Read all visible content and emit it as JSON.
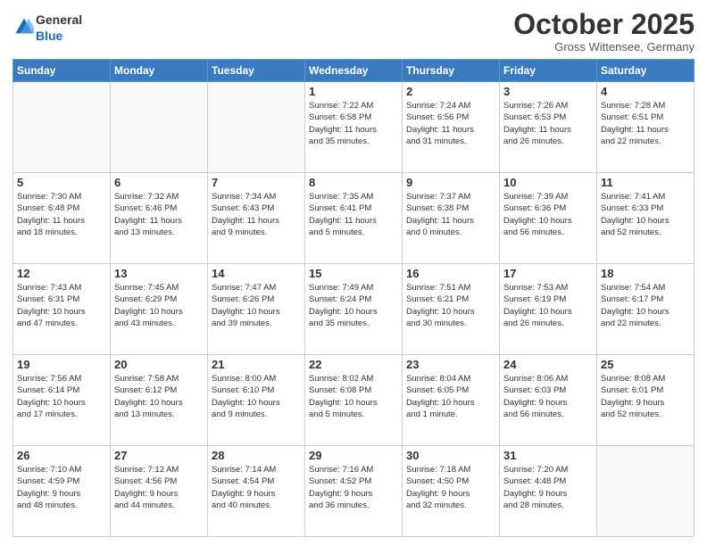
{
  "header": {
    "logo_general": "General",
    "logo_blue": "Blue",
    "month_title": "October 2025",
    "location": "Gross Wittensee, Germany"
  },
  "weekdays": [
    "Sunday",
    "Monday",
    "Tuesday",
    "Wednesday",
    "Thursday",
    "Friday",
    "Saturday"
  ],
  "weeks": [
    [
      {
        "day": "",
        "info": ""
      },
      {
        "day": "",
        "info": ""
      },
      {
        "day": "",
        "info": ""
      },
      {
        "day": "1",
        "info": "Sunrise: 7:22 AM\nSunset: 6:58 PM\nDaylight: 11 hours\nand 35 minutes."
      },
      {
        "day": "2",
        "info": "Sunrise: 7:24 AM\nSunset: 6:56 PM\nDaylight: 11 hours\nand 31 minutes."
      },
      {
        "day": "3",
        "info": "Sunrise: 7:26 AM\nSunset: 6:53 PM\nDaylight: 11 hours\nand 26 minutes."
      },
      {
        "day": "4",
        "info": "Sunrise: 7:28 AM\nSunset: 6:51 PM\nDaylight: 11 hours\nand 22 minutes."
      }
    ],
    [
      {
        "day": "5",
        "info": "Sunrise: 7:30 AM\nSunset: 6:48 PM\nDaylight: 11 hours\nand 18 minutes."
      },
      {
        "day": "6",
        "info": "Sunrise: 7:32 AM\nSunset: 6:46 PM\nDaylight: 11 hours\nand 13 minutes."
      },
      {
        "day": "7",
        "info": "Sunrise: 7:34 AM\nSunset: 6:43 PM\nDaylight: 11 hours\nand 9 minutes."
      },
      {
        "day": "8",
        "info": "Sunrise: 7:35 AM\nSunset: 6:41 PM\nDaylight: 11 hours\nand 5 minutes."
      },
      {
        "day": "9",
        "info": "Sunrise: 7:37 AM\nSunset: 6:38 PM\nDaylight: 11 hours\nand 0 minutes."
      },
      {
        "day": "10",
        "info": "Sunrise: 7:39 AM\nSunset: 6:36 PM\nDaylight: 10 hours\nand 56 minutes."
      },
      {
        "day": "11",
        "info": "Sunrise: 7:41 AM\nSunset: 6:33 PM\nDaylight: 10 hours\nand 52 minutes."
      }
    ],
    [
      {
        "day": "12",
        "info": "Sunrise: 7:43 AM\nSunset: 6:31 PM\nDaylight: 10 hours\nand 47 minutes."
      },
      {
        "day": "13",
        "info": "Sunrise: 7:45 AM\nSunset: 6:29 PM\nDaylight: 10 hours\nand 43 minutes."
      },
      {
        "day": "14",
        "info": "Sunrise: 7:47 AM\nSunset: 6:26 PM\nDaylight: 10 hours\nand 39 minutes."
      },
      {
        "day": "15",
        "info": "Sunrise: 7:49 AM\nSunset: 6:24 PM\nDaylight: 10 hours\nand 35 minutes."
      },
      {
        "day": "16",
        "info": "Sunrise: 7:51 AM\nSunset: 6:21 PM\nDaylight: 10 hours\nand 30 minutes."
      },
      {
        "day": "17",
        "info": "Sunrise: 7:53 AM\nSunset: 6:19 PM\nDaylight: 10 hours\nand 26 minutes."
      },
      {
        "day": "18",
        "info": "Sunrise: 7:54 AM\nSunset: 6:17 PM\nDaylight: 10 hours\nand 22 minutes."
      }
    ],
    [
      {
        "day": "19",
        "info": "Sunrise: 7:56 AM\nSunset: 6:14 PM\nDaylight: 10 hours\nand 17 minutes."
      },
      {
        "day": "20",
        "info": "Sunrise: 7:58 AM\nSunset: 6:12 PM\nDaylight: 10 hours\nand 13 minutes."
      },
      {
        "day": "21",
        "info": "Sunrise: 8:00 AM\nSunset: 6:10 PM\nDaylight: 10 hours\nand 9 minutes."
      },
      {
        "day": "22",
        "info": "Sunrise: 8:02 AM\nSunset: 6:08 PM\nDaylight: 10 hours\nand 5 minutes."
      },
      {
        "day": "23",
        "info": "Sunrise: 8:04 AM\nSunset: 6:05 PM\nDaylight: 10 hours\nand 1 minute."
      },
      {
        "day": "24",
        "info": "Sunrise: 8:06 AM\nSunset: 6:03 PM\nDaylight: 9 hours\nand 56 minutes."
      },
      {
        "day": "25",
        "info": "Sunrise: 8:08 AM\nSunset: 6:01 PM\nDaylight: 9 hours\nand 52 minutes."
      }
    ],
    [
      {
        "day": "26",
        "info": "Sunrise: 7:10 AM\nSunset: 4:59 PM\nDaylight: 9 hours\nand 48 minutes."
      },
      {
        "day": "27",
        "info": "Sunrise: 7:12 AM\nSunset: 4:56 PM\nDaylight: 9 hours\nand 44 minutes."
      },
      {
        "day": "28",
        "info": "Sunrise: 7:14 AM\nSunset: 4:54 PM\nDaylight: 9 hours\nand 40 minutes."
      },
      {
        "day": "29",
        "info": "Sunrise: 7:16 AM\nSunset: 4:52 PM\nDaylight: 9 hours\nand 36 minutes."
      },
      {
        "day": "30",
        "info": "Sunrise: 7:18 AM\nSunset: 4:50 PM\nDaylight: 9 hours\nand 32 minutes."
      },
      {
        "day": "31",
        "info": "Sunrise: 7:20 AM\nSunset: 4:48 PM\nDaylight: 9 hours\nand 28 minutes."
      },
      {
        "day": "",
        "info": ""
      }
    ]
  ]
}
